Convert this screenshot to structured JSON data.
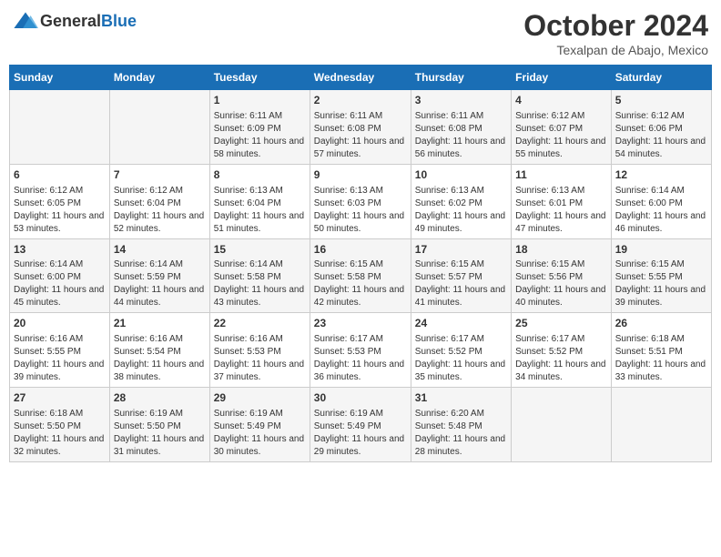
{
  "header": {
    "logo": {
      "line1": "General",
      "line2": "Blue"
    },
    "title": "October 2024",
    "location": "Texalpan de Abajo, Mexico"
  },
  "days_of_week": [
    "Sunday",
    "Monday",
    "Tuesday",
    "Wednesday",
    "Thursday",
    "Friday",
    "Saturday"
  ],
  "weeks": [
    [
      {
        "day": "",
        "sunrise": "",
        "sunset": "",
        "daylight": ""
      },
      {
        "day": "",
        "sunrise": "",
        "sunset": "",
        "daylight": ""
      },
      {
        "day": "1",
        "sunrise": "Sunrise: 6:11 AM",
        "sunset": "Sunset: 6:09 PM",
        "daylight": "Daylight: 11 hours and 58 minutes."
      },
      {
        "day": "2",
        "sunrise": "Sunrise: 6:11 AM",
        "sunset": "Sunset: 6:08 PM",
        "daylight": "Daylight: 11 hours and 57 minutes."
      },
      {
        "day": "3",
        "sunrise": "Sunrise: 6:11 AM",
        "sunset": "Sunset: 6:08 PM",
        "daylight": "Daylight: 11 hours and 56 minutes."
      },
      {
        "day": "4",
        "sunrise": "Sunrise: 6:12 AM",
        "sunset": "Sunset: 6:07 PM",
        "daylight": "Daylight: 11 hours and 55 minutes."
      },
      {
        "day": "5",
        "sunrise": "Sunrise: 6:12 AM",
        "sunset": "Sunset: 6:06 PM",
        "daylight": "Daylight: 11 hours and 54 minutes."
      }
    ],
    [
      {
        "day": "6",
        "sunrise": "Sunrise: 6:12 AM",
        "sunset": "Sunset: 6:05 PM",
        "daylight": "Daylight: 11 hours and 53 minutes."
      },
      {
        "day": "7",
        "sunrise": "Sunrise: 6:12 AM",
        "sunset": "Sunset: 6:04 PM",
        "daylight": "Daylight: 11 hours and 52 minutes."
      },
      {
        "day": "8",
        "sunrise": "Sunrise: 6:13 AM",
        "sunset": "Sunset: 6:04 PM",
        "daylight": "Daylight: 11 hours and 51 minutes."
      },
      {
        "day": "9",
        "sunrise": "Sunrise: 6:13 AM",
        "sunset": "Sunset: 6:03 PM",
        "daylight": "Daylight: 11 hours and 50 minutes."
      },
      {
        "day": "10",
        "sunrise": "Sunrise: 6:13 AM",
        "sunset": "Sunset: 6:02 PM",
        "daylight": "Daylight: 11 hours and 49 minutes."
      },
      {
        "day": "11",
        "sunrise": "Sunrise: 6:13 AM",
        "sunset": "Sunset: 6:01 PM",
        "daylight": "Daylight: 11 hours and 47 minutes."
      },
      {
        "day": "12",
        "sunrise": "Sunrise: 6:14 AM",
        "sunset": "Sunset: 6:00 PM",
        "daylight": "Daylight: 11 hours and 46 minutes."
      }
    ],
    [
      {
        "day": "13",
        "sunrise": "Sunrise: 6:14 AM",
        "sunset": "Sunset: 6:00 PM",
        "daylight": "Daylight: 11 hours and 45 minutes."
      },
      {
        "day": "14",
        "sunrise": "Sunrise: 6:14 AM",
        "sunset": "Sunset: 5:59 PM",
        "daylight": "Daylight: 11 hours and 44 minutes."
      },
      {
        "day": "15",
        "sunrise": "Sunrise: 6:14 AM",
        "sunset": "Sunset: 5:58 PM",
        "daylight": "Daylight: 11 hours and 43 minutes."
      },
      {
        "day": "16",
        "sunrise": "Sunrise: 6:15 AM",
        "sunset": "Sunset: 5:58 PM",
        "daylight": "Daylight: 11 hours and 42 minutes."
      },
      {
        "day": "17",
        "sunrise": "Sunrise: 6:15 AM",
        "sunset": "Sunset: 5:57 PM",
        "daylight": "Daylight: 11 hours and 41 minutes."
      },
      {
        "day": "18",
        "sunrise": "Sunrise: 6:15 AM",
        "sunset": "Sunset: 5:56 PM",
        "daylight": "Daylight: 11 hours and 40 minutes."
      },
      {
        "day": "19",
        "sunrise": "Sunrise: 6:15 AM",
        "sunset": "Sunset: 5:55 PM",
        "daylight": "Daylight: 11 hours and 39 minutes."
      }
    ],
    [
      {
        "day": "20",
        "sunrise": "Sunrise: 6:16 AM",
        "sunset": "Sunset: 5:55 PM",
        "daylight": "Daylight: 11 hours and 39 minutes."
      },
      {
        "day": "21",
        "sunrise": "Sunrise: 6:16 AM",
        "sunset": "Sunset: 5:54 PM",
        "daylight": "Daylight: 11 hours and 38 minutes."
      },
      {
        "day": "22",
        "sunrise": "Sunrise: 6:16 AM",
        "sunset": "Sunset: 5:53 PM",
        "daylight": "Daylight: 11 hours and 37 minutes."
      },
      {
        "day": "23",
        "sunrise": "Sunrise: 6:17 AM",
        "sunset": "Sunset: 5:53 PM",
        "daylight": "Daylight: 11 hours and 36 minutes."
      },
      {
        "day": "24",
        "sunrise": "Sunrise: 6:17 AM",
        "sunset": "Sunset: 5:52 PM",
        "daylight": "Daylight: 11 hours and 35 minutes."
      },
      {
        "day": "25",
        "sunrise": "Sunrise: 6:17 AM",
        "sunset": "Sunset: 5:52 PM",
        "daylight": "Daylight: 11 hours and 34 minutes."
      },
      {
        "day": "26",
        "sunrise": "Sunrise: 6:18 AM",
        "sunset": "Sunset: 5:51 PM",
        "daylight": "Daylight: 11 hours and 33 minutes."
      }
    ],
    [
      {
        "day": "27",
        "sunrise": "Sunrise: 6:18 AM",
        "sunset": "Sunset: 5:50 PM",
        "daylight": "Daylight: 11 hours and 32 minutes."
      },
      {
        "day": "28",
        "sunrise": "Sunrise: 6:19 AM",
        "sunset": "Sunset: 5:50 PM",
        "daylight": "Daylight: 11 hours and 31 minutes."
      },
      {
        "day": "29",
        "sunrise": "Sunrise: 6:19 AM",
        "sunset": "Sunset: 5:49 PM",
        "daylight": "Daylight: 11 hours and 30 minutes."
      },
      {
        "day": "30",
        "sunrise": "Sunrise: 6:19 AM",
        "sunset": "Sunset: 5:49 PM",
        "daylight": "Daylight: 11 hours and 29 minutes."
      },
      {
        "day": "31",
        "sunrise": "Sunrise: 6:20 AM",
        "sunset": "Sunset: 5:48 PM",
        "daylight": "Daylight: 11 hours and 28 minutes."
      },
      {
        "day": "",
        "sunrise": "",
        "sunset": "",
        "daylight": ""
      },
      {
        "day": "",
        "sunrise": "",
        "sunset": "",
        "daylight": ""
      }
    ]
  ]
}
